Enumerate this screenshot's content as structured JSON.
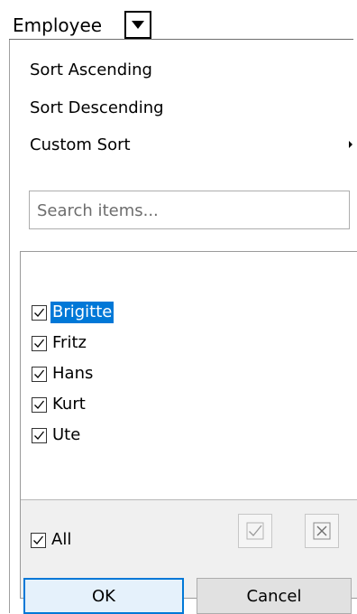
{
  "header": {
    "column_label": "Employee",
    "dropdown_icon": "chevron-down-icon"
  },
  "menu": {
    "sort_ascending": "Sort Ascending",
    "sort_descending": "Sort Descending",
    "custom_sort": "Custom Sort",
    "submenu_icon": "chevron-right-icon"
  },
  "search": {
    "value": "",
    "placeholder": "Search items..."
  },
  "items": [
    {
      "label": "Brigitte",
      "checked": true,
      "selected": true
    },
    {
      "label": "Fritz",
      "checked": true,
      "selected": false
    },
    {
      "label": "Hans",
      "checked": true,
      "selected": false
    },
    {
      "label": "Kurt",
      "checked": true,
      "selected": false
    },
    {
      "label": "Ute",
      "checked": true,
      "selected": false
    }
  ],
  "footer": {
    "all_label": "All",
    "all_checked": true,
    "check_all_icon": "check-all-icon",
    "uncheck_all_icon": "uncheck-all-icon"
  },
  "buttons": {
    "ok": "OK",
    "cancel": "Cancel"
  },
  "colors": {
    "selection": "#0078d7",
    "footer_bg": "#f0f0f0"
  }
}
